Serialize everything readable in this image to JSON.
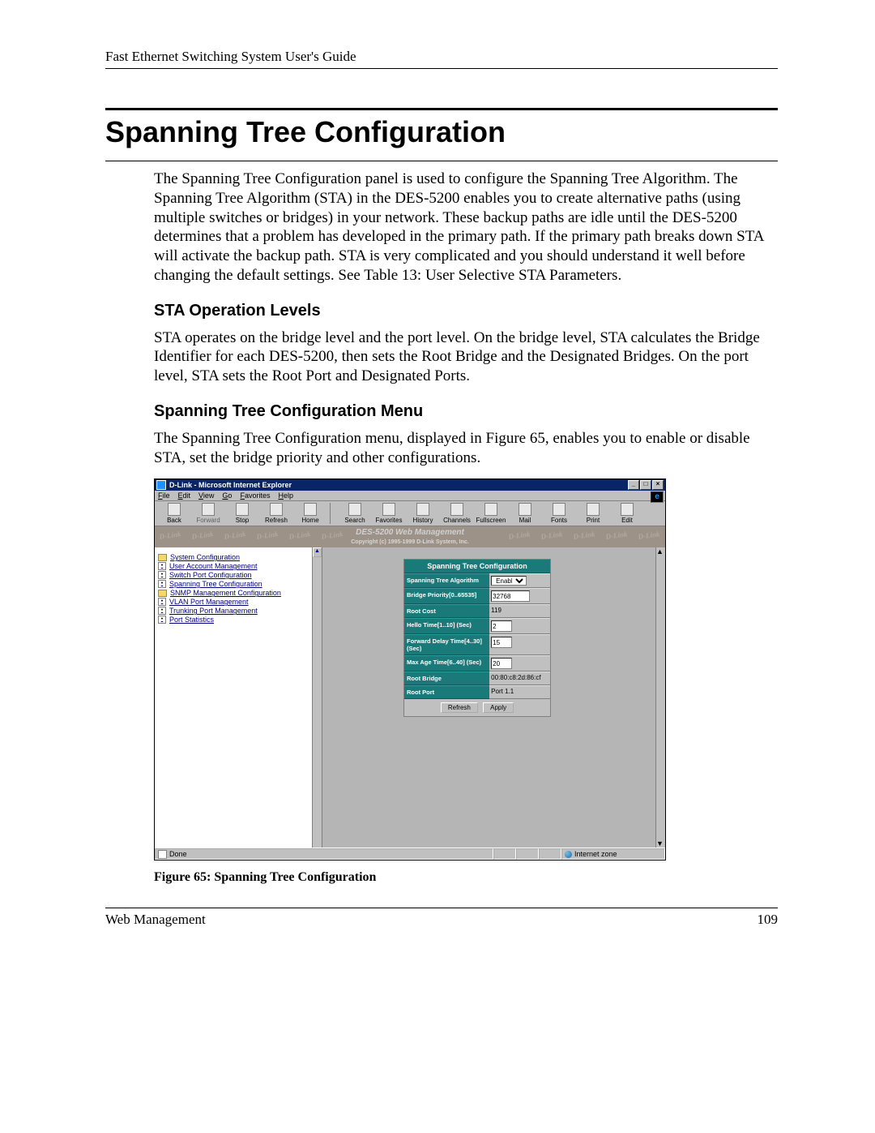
{
  "running_head": "Fast Ethernet Switching System User's Guide",
  "section_title": "Spanning Tree Configuration",
  "para1": "The Spanning Tree Configuration panel is used to configure the Spanning Tree Algorithm. The Spanning Tree Algorithm (STA) in the DES-5200 enables you to create alternative paths (using multiple switches or bridges) in your network. These backup paths are idle until the DES-5200 determines that a problem has developed in the primary path. If the primary path breaks down STA will activate the backup path. STA is very complicated and you should understand it well before changing the default settings. See Table 13: User Selective STA Parameters.",
  "sub1": "STA Operation Levels",
  "para2": "STA operates on the bridge level and the port level. On the bridge level, STA calculates the Bridge Identifier for each DES-5200, then sets the Root Bridge and the Designated Bridges. On the port level, STA sets the Root Port and Designated Ports.",
  "sub2": "Spanning Tree Configuration Menu",
  "para3": "The Spanning Tree Configuration menu, displayed in Figure 65, enables you to enable or disable STA, set the bridge priority and other configurations.",
  "figure_caption": "Figure 65: Spanning Tree Configuration",
  "footer_left": "Web Management",
  "footer_right": "109",
  "ie": {
    "title": "D-Link - Microsoft Internet Explorer",
    "menu": [
      "File",
      "Edit",
      "View",
      "Go",
      "Favorites",
      "Help"
    ],
    "toolbar": [
      "Back",
      "Forward",
      "Stop",
      "Refresh",
      "Home",
      "Search",
      "Favorites",
      "History",
      "Channels",
      "Fullscreen",
      "Mail",
      "Fonts",
      "Print",
      "Edit"
    ],
    "banner_line1": "DES-5200 Web Management",
    "banner_line2": "Copyright (c) 1995-1999 D-Link System, Inc.",
    "status_left": "Done",
    "status_right": "Internet zone"
  },
  "nav": [
    {
      "icon": "folder",
      "label": "System Configuration"
    },
    {
      "icon": "box",
      "label": "User Account Management"
    },
    {
      "icon": "box",
      "label": "Switch Port Configuration"
    },
    {
      "icon": "box",
      "label": "Spanning Tree Configuration"
    },
    {
      "icon": "folder",
      "label": "SNMP Management Configuration"
    },
    {
      "icon": "box",
      "label": "VLAN Port Management"
    },
    {
      "icon": "box",
      "label": "Trunking Port Management"
    },
    {
      "icon": "box",
      "label": "Port Statistics"
    }
  ],
  "panel": {
    "title": "Spanning Tree Configuration",
    "rows": [
      {
        "label": "Spanning Tree Algorithm",
        "value": "Enable",
        "type": "select"
      },
      {
        "label": "Bridge Priority[0..65535]",
        "value": "32768",
        "type": "input"
      },
      {
        "label": "Root Cost",
        "value": "119",
        "type": "text"
      },
      {
        "label": "Hello Time[1..10] (Sec)",
        "value": "2",
        "type": "input-tiny"
      },
      {
        "label": "Forward Delay Time[4..30] (Sec)",
        "value": "15",
        "type": "input-tiny"
      },
      {
        "label": "Max Age Time[6..40] (Sec)",
        "value": "20",
        "type": "input-tiny"
      },
      {
        "label": "Root Bridge",
        "value": "00:80:c8:2d:86:cf",
        "type": "text"
      },
      {
        "label": "Root Port",
        "value": "Port 1.1",
        "type": "text"
      }
    ],
    "btn_refresh": "Refresh",
    "btn_apply": "Apply"
  }
}
